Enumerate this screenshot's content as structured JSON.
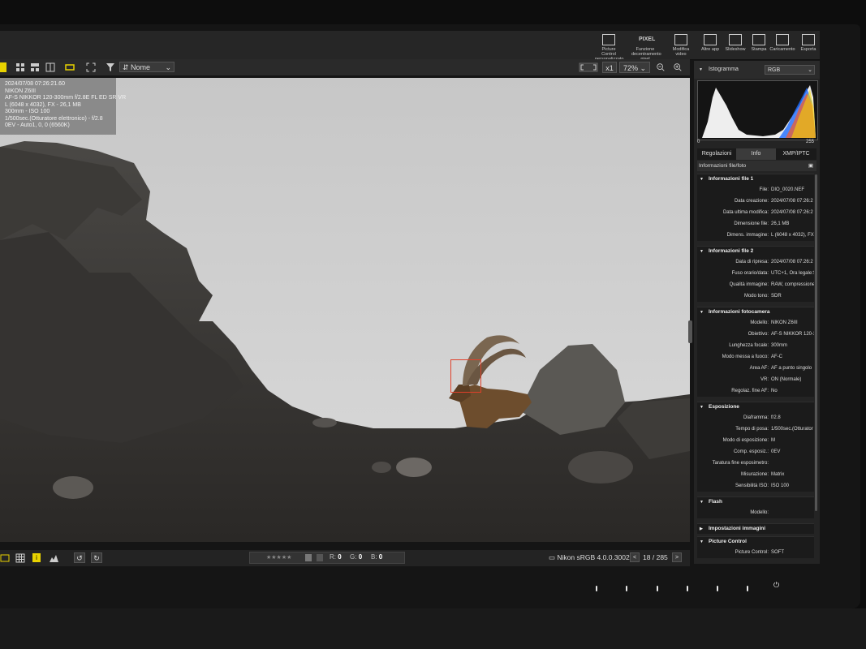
{
  "toolbar": {
    "buttons": [
      {
        "label": "Picture Control personalizzato",
        "icon": "picture-control-icon"
      },
      {
        "label": "Funzione decentramento pixel",
        "icon": "pixel-shift-icon",
        "badge": "PIXEL"
      },
      {
        "label": "Modifica video",
        "icon": "video-edit-icon"
      },
      {
        "label": "Altre app",
        "icon": "apps-icon"
      },
      {
        "label": "Slideshow",
        "icon": "slideshow-icon"
      },
      {
        "label": "Stampa",
        "icon": "print-icon"
      },
      {
        "label": "Caricamento",
        "icon": "upload-icon"
      },
      {
        "label": "Esporta",
        "icon": "export-icon"
      }
    ]
  },
  "viewbar": {
    "sort_label": "Nome",
    "zoom_multiplier": "x1",
    "zoom_level": "72%"
  },
  "overlay": {
    "lines": [
      "2024/07/08 07:26:21.60",
      "NIKON Z6III",
      "AF-S NIKKOR 120-300mm f/2.8E FL ED SR VR",
      "L (6048 x 4032), FX - 26,1 MB",
      "300mm - ISO 100",
      "1/500sec.(Otturatore elettronico) - f/2.8",
      "0EV - Auto1, 0, 0 (6560K)"
    ]
  },
  "bottombar": {
    "r_label": "R:",
    "r_value": "0",
    "g_label": "G:",
    "g_value": "0",
    "b_label": "B:",
    "b_value": "0",
    "color_profile": "Nikon sRGB 4.0.0.3002",
    "page_current": "18",
    "page_sep": "/",
    "page_total": "285"
  },
  "panel": {
    "histogram_title": "Istogramma",
    "histogram_channel": "RGB",
    "hist_min": "0",
    "hist_max": "255",
    "tabs": [
      "Regolazioni",
      "Info",
      "XMP/IPTC"
    ],
    "active_tab": "Info",
    "subheader": "Informazioni file/foto",
    "sections": [
      {
        "title": "Informazioni file 1",
        "rows": [
          {
            "label": "File:",
            "value": "DIO_0020.NEF"
          },
          {
            "label": "Data creazione:",
            "value": "2024/07/08 07:26:2"
          },
          {
            "label": "Data ultima modifica:",
            "value": "2024/07/08 07:26:2"
          },
          {
            "label": "Dimensione file:",
            "value": "26,1 MB"
          },
          {
            "label": "Dimens. immagine:",
            "value": "L (6048 x 4032), FX"
          }
        ]
      },
      {
        "title": "Informazioni file 2",
        "rows": [
          {
            "label": "Data di ripresa:",
            "value": "2024/07/08 07:26:2"
          },
          {
            "label": "Fuso orario/data:",
            "value": "UTC+1, Ora legale:S"
          },
          {
            "label": "Qualità immagine:",
            "value": "RAW, compressione"
          },
          {
            "label": "Modo tono:",
            "value": "SDR"
          }
        ]
      },
      {
        "title": "Informazioni fotocamera",
        "rows": [
          {
            "label": "Modello:",
            "value": "NIKON Z6III"
          },
          {
            "label": "Obiettivo:",
            "value": "AF-S NIKKOR 120-3"
          },
          {
            "label": "Lunghezza focale:",
            "value": "300mm"
          },
          {
            "label": "Modo messa a fuoco:",
            "value": "AF-C"
          },
          {
            "label": "Area AF:",
            "value": "AF a punto singolo"
          },
          {
            "label": "VR:",
            "value": "ON (Normale)"
          },
          {
            "label": "Regolaz. fine AF:",
            "value": "No"
          }
        ]
      },
      {
        "title": "Esposizione",
        "rows": [
          {
            "label": "Diaframma:",
            "value": "f/2.8"
          },
          {
            "label": "Tempo di posa:",
            "value": "1/500sec.(Otturator"
          },
          {
            "label": "Modo di esposizione:",
            "value": "M"
          },
          {
            "label": "Comp. esposiz.:",
            "value": "0EV"
          },
          {
            "label": "Taratura fine esposimetro:",
            "value": ""
          },
          {
            "label": "Misurazione:",
            "value": "Matrix"
          },
          {
            "label": "Sensibilità ISO:",
            "value": "ISO 100"
          }
        ]
      },
      {
        "title": "Flash",
        "rows": [
          {
            "label": "Modello:",
            "value": ""
          }
        ]
      },
      {
        "title": "Impostazioni immagini",
        "rows": [],
        "closed": true
      },
      {
        "title": "Picture Control",
        "rows": [
          {
            "label": "Picture Control:",
            "value": "SOFT"
          }
        ]
      }
    ]
  },
  "colors": {
    "af_box": "#e0402a",
    "accent_yellow": "#e8d200"
  }
}
